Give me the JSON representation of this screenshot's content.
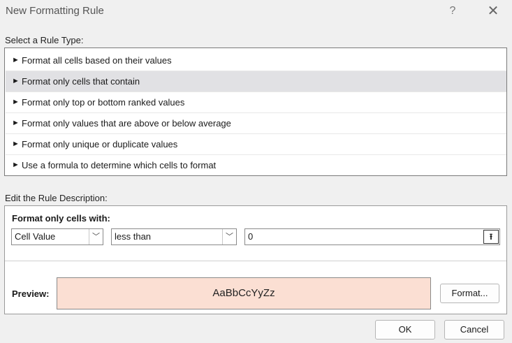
{
  "window": {
    "title": "New Formatting Rule",
    "help_label": "?",
    "close_label": "✕"
  },
  "rule_type": {
    "label": "Select a Rule Type:",
    "items": [
      {
        "label": "Format all cells based on their values",
        "selected": false
      },
      {
        "label": "Format only cells that contain",
        "selected": true
      },
      {
        "label": "Format only top or bottom ranked values",
        "selected": false
      },
      {
        "label": "Format only values that are above or below average",
        "selected": false
      },
      {
        "label": "Format only unique or duplicate values",
        "selected": false
      },
      {
        "label": "Use a formula to determine which cells to format",
        "selected": false
      }
    ]
  },
  "description": {
    "label": "Edit the Rule Description:",
    "condition_label": "Format only cells with:",
    "field1_value": "Cell Value",
    "field2_value": "less than",
    "value_input": "0",
    "preview_label": "Preview:",
    "preview_text": "AaBbCcYyZz",
    "preview_fill": "#fbdfd3",
    "format_button": "Format..."
  },
  "footer": {
    "ok_label": "OK",
    "cancel_label": "Cancel"
  },
  "icons": {
    "item_arrow": "►",
    "chevron": "﹀",
    "range_select": "⭱"
  }
}
